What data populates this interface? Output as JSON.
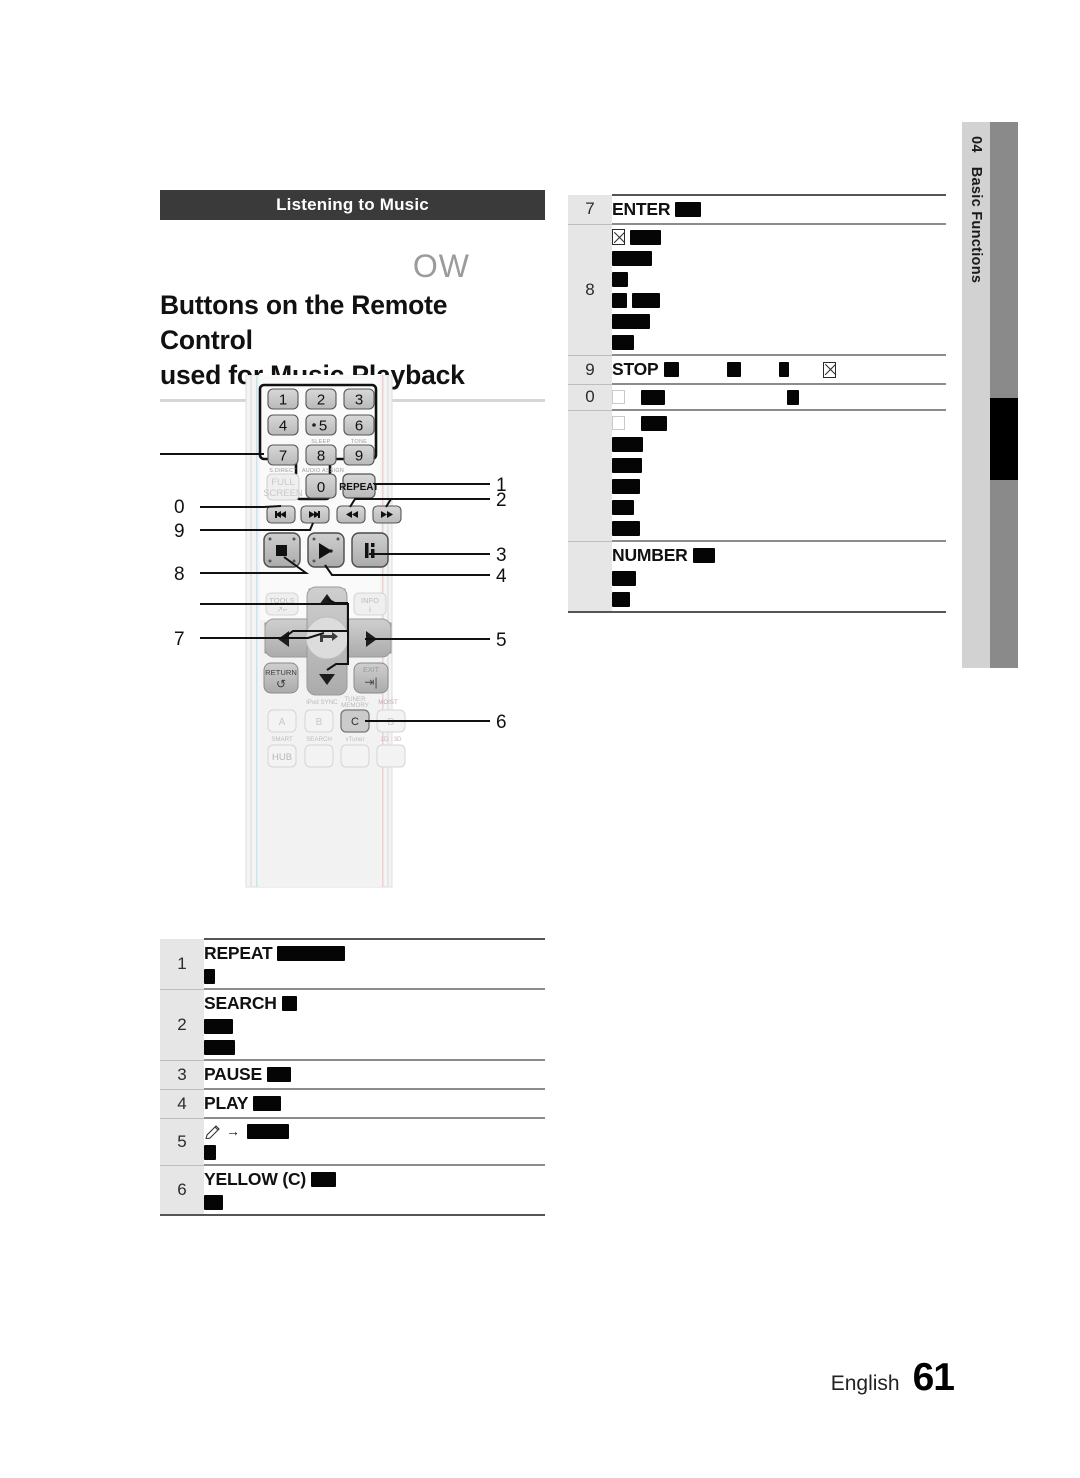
{
  "document": {
    "section_banner": "Listening to Music",
    "partial_text_fragment": "OW",
    "heading_line1": "Buttons on the Remote Control",
    "heading_line2": "used for Music Playback"
  },
  "chapter_tab": {
    "number": "04",
    "title": "Basic Functions",
    "tab_bg": "#d2d2d2",
    "bar_bg": "#8a8a8a",
    "marker_bg": "#000000"
  },
  "remote_diagram": {
    "caption_numbers_left": [
      "0",
      "9",
      "8",
      "7"
    ],
    "caption_numbers_right": [
      "1",
      "2",
      "3",
      "4",
      "5",
      "6"
    ],
    "keypad": {
      "digits": [
        "1",
        "2",
        "3",
        "4",
        "5",
        "6",
        "7",
        "8",
        "9",
        "0"
      ],
      "sub_labels": [
        "SLEEP",
        "TONE",
        "S.DIRECT",
        "AUDIO ASSIGN"
      ]
    },
    "buttons": {
      "full_screen": "FULL SCREEN",
      "repeat": "REPEAT",
      "tools": "TOOLS",
      "info": "INFO",
      "return": "RETURN",
      "exit": "EXIT",
      "color_a": "A",
      "color_b": "B",
      "color_c": "C",
      "color_d": "D",
      "smart_hub_top": "SMART",
      "smart_hub_bottom": "HUB",
      "ipod_sync": "iPod SYNC",
      "tuner_memory": "TUNER MEMORY",
      "moist": "MOIST",
      "search": "SEARCH",
      "vtuner": "vTuner",
      "dimension": "2D : 3D"
    }
  },
  "left_table": {
    "rows": [
      {
        "index": "1",
        "lines": [
          {
            "label": "REPEAT",
            "blocks": [
              68
            ]
          },
          {
            "label": "",
            "blocks": [
              11
            ]
          }
        ]
      },
      {
        "index": "2",
        "lines": [
          {
            "label": "SEARCH",
            "blocks": [
              15
            ]
          },
          {
            "label": "",
            "blocks": [
              29
            ]
          },
          {
            "label": "",
            "blocks": [
              31
            ]
          }
        ]
      },
      {
        "index": "3",
        "lines": [
          {
            "label": "PAUSE",
            "blocks": [
              24
            ]
          }
        ]
      },
      {
        "index": "4",
        "lines": [
          {
            "label": "PLAY",
            "blocks": [
              28
            ]
          }
        ]
      },
      {
        "index": "5",
        "lines": [
          {
            "label": "",
            "icon": "pencil-arrow",
            "blocks": [
              42
            ]
          },
          {
            "label": "",
            "blocks": [
              12
            ]
          }
        ]
      },
      {
        "index": "6",
        "lines": [
          {
            "label": "YELLOW (C)",
            "blocks": [
              25
            ]
          },
          {
            "label": "",
            "blocks": [
              19
            ]
          }
        ]
      }
    ]
  },
  "right_table": {
    "rows": [
      {
        "index": "7",
        "lines": [
          {
            "label": "ENTER",
            "blocks": [
              26
            ]
          }
        ]
      },
      {
        "index": "8",
        "lines": [
          {
            "label": "",
            "icon": "x-box",
            "blocks": [
              31
            ]
          },
          {
            "label": "",
            "blocks": [
              40
            ]
          },
          {
            "label": "",
            "blocks": [
              16
            ]
          },
          {
            "label": "",
            "blocks": [
              15,
              28
            ]
          },
          {
            "label": "",
            "blocks": [
              38
            ]
          },
          {
            "label": "",
            "blocks": [
              22
            ]
          }
        ]
      },
      {
        "index": "9",
        "lines": [
          {
            "label": "STOP",
            "blocks": [
              15
            ],
            "extra_blocks": [
              14,
              10
            ],
            "extra_xbox": true
          }
        ]
      },
      {
        "index": "0",
        "lines": [
          {
            "label": "",
            "icon": "hollow-box",
            "blocks": [
              24
            ],
            "gap_blocks": [
              12
            ]
          }
        ]
      },
      {
        "index": "",
        "lines": [
          {
            "label": "",
            "icon": "hollow-box",
            "blocks": [
              26
            ]
          },
          {
            "label": "",
            "blocks": [
              31
            ]
          },
          {
            "label": "",
            "blocks": [
              30
            ]
          },
          {
            "label": "",
            "blocks": [
              28
            ]
          },
          {
            "label": "",
            "blocks": [
              22
            ]
          },
          {
            "label": "",
            "blocks": [
              28
            ]
          }
        ]
      },
      {
        "index": "",
        "lines": [
          {
            "label": "NUMBER",
            "blocks": [
              22
            ]
          },
          {
            "label": "",
            "blocks": [
              24
            ]
          },
          {
            "label": "",
            "blocks": [
              18
            ]
          }
        ]
      }
    ]
  },
  "footer": {
    "language": "English",
    "page_number": "61"
  }
}
